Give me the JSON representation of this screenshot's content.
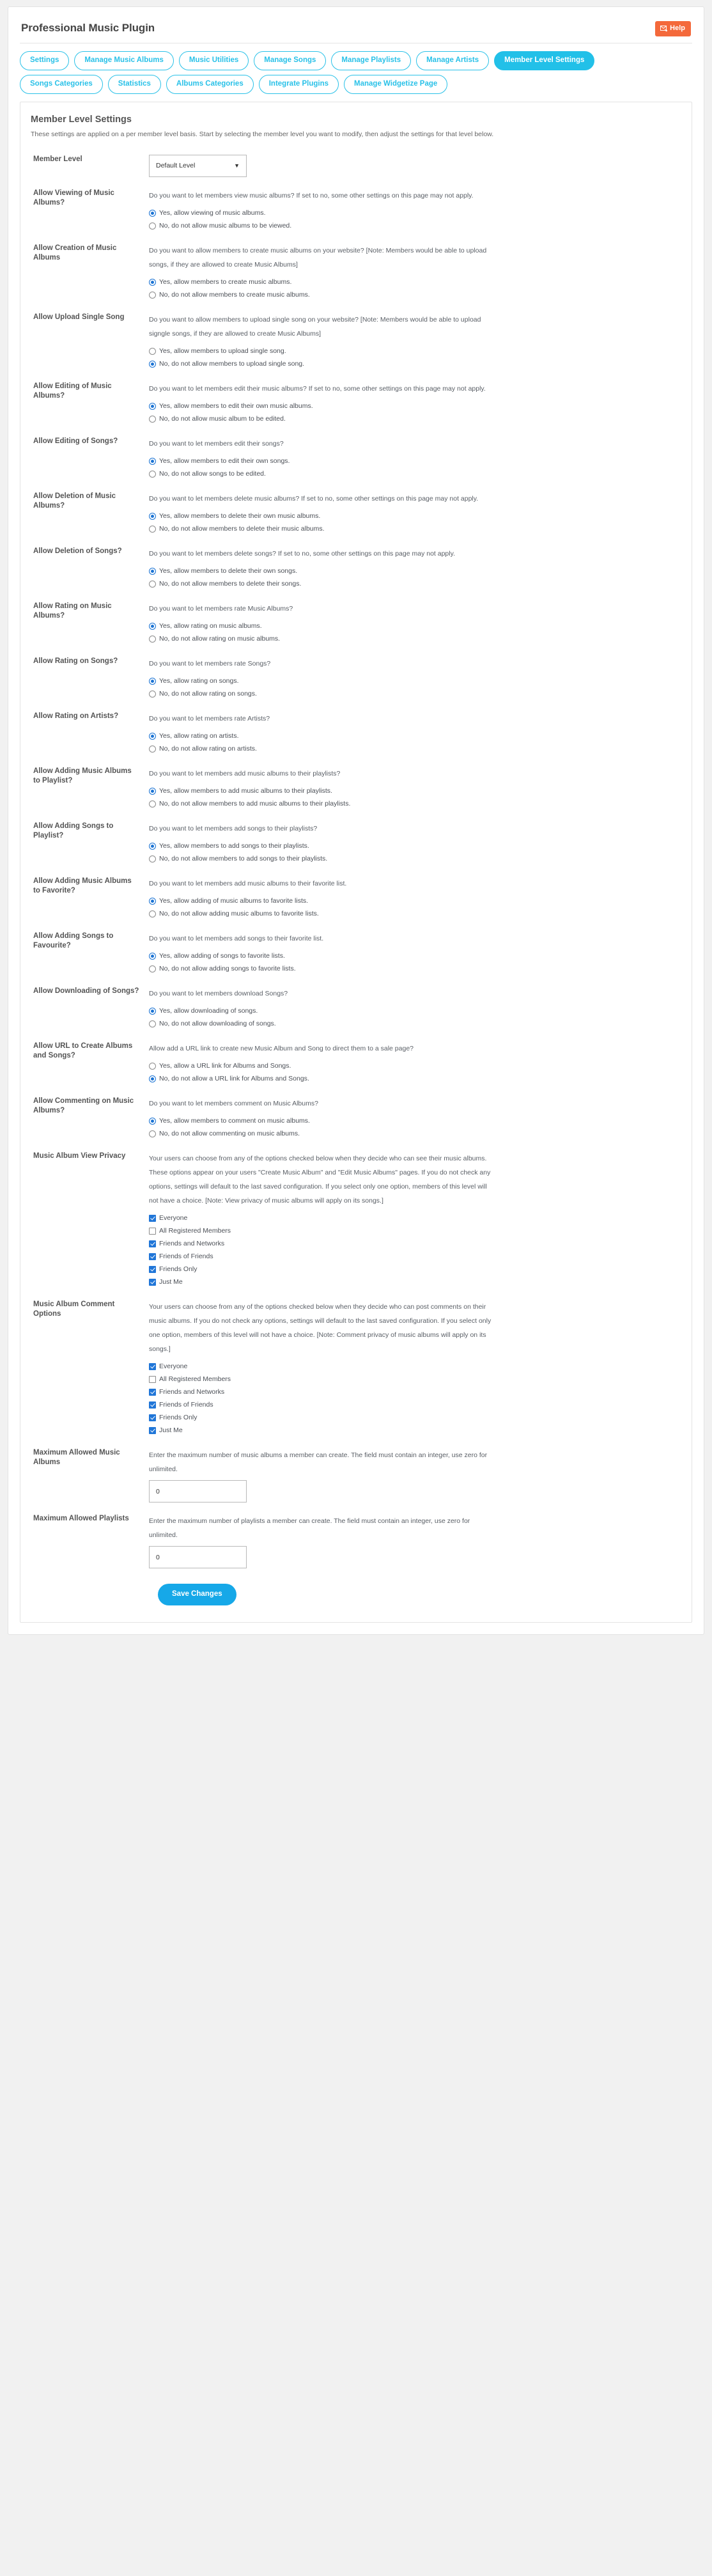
{
  "header": {
    "title": "Professional Music Plugin",
    "help_label": "Help",
    "help_icon": "envelope-icon"
  },
  "tabs": [
    {
      "label": "Settings",
      "active": false
    },
    {
      "label": "Manage Music Albums",
      "active": false
    },
    {
      "label": "Music Utilities",
      "active": false
    },
    {
      "label": "Manage Songs",
      "active": false
    },
    {
      "label": "Manage Playlists",
      "active": false
    },
    {
      "label": "Manage Artists",
      "active": false
    },
    {
      "label": "Member Level Settings",
      "active": true
    },
    {
      "label": "Songs Categories",
      "active": false
    },
    {
      "label": "Statistics",
      "active": false
    },
    {
      "label": "Albums Categories",
      "active": false
    },
    {
      "label": "Integrate Plugins",
      "active": false
    },
    {
      "label": "Manage Widgetize Page",
      "active": false
    }
  ],
  "settings": {
    "title": "Member Level Settings",
    "description": "These settings are applied on a per member level basis. Start by selecting the member level you want to modify, then adjust the settings for that level below."
  },
  "member_level": {
    "label": "Member Level",
    "selected": "Default Level",
    "caret": "chevron-down-icon"
  },
  "rows": [
    {
      "label": "Allow Viewing of Music Albums?",
      "desc": "Do you want to let members view music albums? If set to no, some other settings on this page may not apply.",
      "options": [
        {
          "text": "Yes, allow viewing of music albums.",
          "checked": true
        },
        {
          "text": "No, do not allow music albums to be viewed.",
          "checked": false
        }
      ]
    },
    {
      "label": "Allow Creation of Music Albums",
      "desc": "Do you want to allow members to create music albums on your website? [Note: Members would be able to upload songs, if they are allowed to create Music Albums]",
      "options": [
        {
          "text": "Yes, allow members to create music albums.",
          "checked": true
        },
        {
          "text": "No, do not allow members to create music albums.",
          "checked": false
        }
      ]
    },
    {
      "label": "Allow Upload Single Song",
      "desc": "Do you want to allow members to upload single song on your website? [Note: Members would be able to upload signgle songs, if they are allowed to create Music Albums]",
      "options": [
        {
          "text": "Yes, allow members to upload single song.",
          "checked": false
        },
        {
          "text": "No, do not allow members to upload single song.",
          "checked": true
        }
      ]
    },
    {
      "label": "Allow Editing of Music Albums?",
      "desc": "Do you want to let members edit their music albums? If set to no, some other settings on this page may not apply.",
      "options": [
        {
          "text": "Yes, allow members to edit their own music albums.",
          "checked": true
        },
        {
          "text": "No, do not allow music album to be edited.",
          "checked": false
        }
      ]
    },
    {
      "label": "Allow Editing of Songs?",
      "desc": "Do you want to let members edit their songs?",
      "options": [
        {
          "text": "Yes, allow members to edit their own songs.",
          "checked": true
        },
        {
          "text": "No, do not allow songs to be edited.",
          "checked": false
        }
      ]
    },
    {
      "label": "Allow Deletion of Music Albums?",
      "desc": "Do you want to let members delete music albums? If set to no, some other settings on this page may not apply.",
      "options": [
        {
          "text": "Yes, allow members to delete their own music albums.",
          "checked": true
        },
        {
          "text": "No, do not allow members to delete their music albums.",
          "checked": false
        }
      ]
    },
    {
      "label": "Allow Deletion of Songs?",
      "desc": "Do you want to let members delete songs? If set to no, some other settings on this page may not apply.",
      "options": [
        {
          "text": "Yes, allow members to delete their own songs.",
          "checked": true
        },
        {
          "text": "No, do not allow members to delete their songs.",
          "checked": false
        }
      ]
    },
    {
      "label": "Allow Rating on Music Albums?",
      "desc": "Do you want to let members rate Music Albums?",
      "options": [
        {
          "text": "Yes, allow rating on music albums.",
          "checked": true
        },
        {
          "text": "No, do not allow rating on music albums.",
          "checked": false
        }
      ]
    },
    {
      "label": "Allow Rating on Songs?",
      "desc": "Do you want to let members rate Songs?",
      "options": [
        {
          "text": "Yes, allow rating on songs.",
          "checked": true
        },
        {
          "text": "No, do not allow rating on songs.",
          "checked": false
        }
      ]
    },
    {
      "label": "Allow Rating on Artists?",
      "desc": "Do you want to let members rate Artists?",
      "options": [
        {
          "text": "Yes, allow rating on artists.",
          "checked": true
        },
        {
          "text": "No, do not allow rating on artists.",
          "checked": false
        }
      ]
    },
    {
      "label": "Allow Adding Music Albums to Playlist?",
      "desc": "Do you want to let members add music albums to their playlists?",
      "options": [
        {
          "text": "Yes, allow members to add music albums to their playlists.",
          "checked": true
        },
        {
          "text": "No, do not allow members to add music albums to their playlists.",
          "checked": false
        }
      ]
    },
    {
      "label": "Allow Adding Songs to Playlist?",
      "desc": "Do you want to let members add songs to their playlists?",
      "options": [
        {
          "text": "Yes, allow members to add songs to their playlists.",
          "checked": true
        },
        {
          "text": "No, do not allow members to add songs to their playlists.",
          "checked": false
        }
      ]
    },
    {
      "label": "Allow Adding Music Albums to Favorite?",
      "desc": "Do you want to let members add music albums to their favorite list.",
      "options": [
        {
          "text": "Yes, allow adding of music albums to favorite lists.",
          "checked": true
        },
        {
          "text": "No, do not allow adding music albums to favorite lists.",
          "checked": false
        }
      ]
    },
    {
      "label": "Allow Adding Songs to Favourite?",
      "desc": "Do you want to let members add songs to their favorite list.",
      "options": [
        {
          "text": "Yes, allow adding of songs to favorite lists.",
          "checked": true
        },
        {
          "text": "No, do not allow adding songs to favorite lists.",
          "checked": false
        }
      ]
    },
    {
      "label": "Allow Downloading of Songs?",
      "desc": "Do you want to let members download Songs?",
      "options": [
        {
          "text": "Yes, allow downloading of songs.",
          "checked": true
        },
        {
          "text": "No, do not allow downloading of songs.",
          "checked": false
        }
      ]
    },
    {
      "label": "Allow URL to Create Albums and Songs?",
      "desc": "Allow add a URL link to create new Music Album and Song to direct them to a sale page?",
      "options": [
        {
          "text": "Yes, allow a URL link for Albums and Songs.",
          "checked": false
        },
        {
          "text": "No, do not allow a URL link for Albums and Songs.",
          "checked": true
        }
      ]
    },
    {
      "label": "Allow Commenting on Music Albums?",
      "desc": "Do you want to let members comment on Music Albums?",
      "options": [
        {
          "text": "Yes, allow members to comment on music albums.",
          "checked": true
        },
        {
          "text": "No, do not allow commenting on music albums.",
          "checked": false
        }
      ]
    }
  ],
  "privacy_rows": [
    {
      "label": "Music Album View Privacy",
      "desc": "Your users can choose from any of the options checked below when they decide who can see their music albums. These options appear on your users \"Create Music Album\" and \"Edit Music Albums\" pages. If you do not check any options, settings will default to the last saved configuration. If you select only one option, members of this level will not have a choice. [Note: View privacy of music albums will apply on its songs.]",
      "options": [
        {
          "text": "Everyone",
          "checked": true
        },
        {
          "text": "All Registered Members",
          "checked": false
        },
        {
          "text": "Friends and Networks",
          "checked": true
        },
        {
          "text": "Friends of Friends",
          "checked": true
        },
        {
          "text": "Friends Only",
          "checked": true
        },
        {
          "text": "Just Me",
          "checked": true
        }
      ]
    },
    {
      "label": "Music Album Comment Options",
      "desc": "Your users can choose from any of the options checked below when they decide who can post comments on their music albums. If you do not check any options, settings will default to the last saved configuration. If you select only one option, members of this level will not have a choice. [Note: Comment privacy of music albums will apply on its songs.]",
      "options": [
        {
          "text": "Everyone",
          "checked": true
        },
        {
          "text": "All Registered Members",
          "checked": false
        },
        {
          "text": "Friends and Networks",
          "checked": true
        },
        {
          "text": "Friends of Friends",
          "checked": true
        },
        {
          "text": "Friends Only",
          "checked": true
        },
        {
          "text": "Just Me",
          "checked": true
        }
      ]
    }
  ],
  "number_rows": [
    {
      "label": "Maximum Allowed Music Albums",
      "desc": "Enter the maximum number of music albums a member can create. The field must contain an integer, use zero for unlimited.",
      "value": "0"
    },
    {
      "label": "Maximum Allowed Playlists",
      "desc": "Enter the maximum number of playlists a member can create. The field must contain an integer, use zero for unlimited.",
      "value": "0"
    }
  ],
  "save": {
    "label": "Save Changes"
  },
  "colors": {
    "accent": "#22c0e8",
    "help": "#f4693b",
    "save": "#16a8e8",
    "radio": "#1a73d4",
    "checkbox": "#2076d8"
  }
}
